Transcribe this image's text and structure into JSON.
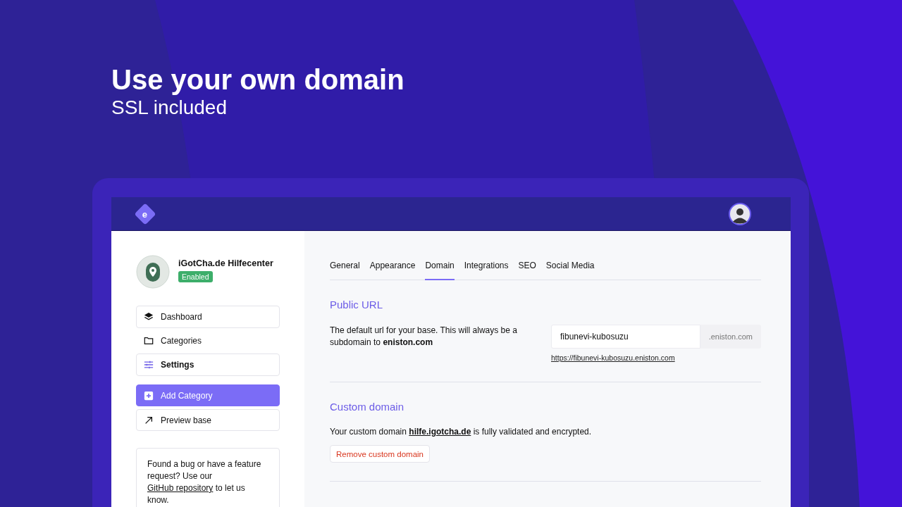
{
  "hero": {
    "title": "Use your own domain",
    "subtitle": "SSL included"
  },
  "topbar": {
    "logo_letter": "e"
  },
  "base": {
    "name": "iGotCha.de Hilfecenter",
    "status": "Enabled"
  },
  "nav": [
    {
      "label": "Dashboard",
      "kind": "layers",
      "boxed": true,
      "selected": false
    },
    {
      "label": "Categories",
      "kind": "folder",
      "boxed": false,
      "selected": false
    },
    {
      "label": "Settings",
      "kind": "sliders",
      "boxed": true,
      "selected": true
    }
  ],
  "actions": [
    {
      "label": "Add Category",
      "kind": "primary"
    },
    {
      "label": "Preview base",
      "kind": "secondary"
    }
  ],
  "feedback": {
    "before": "Found a bug or have a feature request? Use our ",
    "link": "GitHub repository",
    "after": " to let us know."
  },
  "tabs": [
    {
      "label": "General",
      "selected": false
    },
    {
      "label": "Appearance",
      "selected": false
    },
    {
      "label": "Domain",
      "selected": true
    },
    {
      "label": "Integrations",
      "selected": false
    },
    {
      "label": "SEO",
      "selected": false
    },
    {
      "label": "Social Media",
      "selected": false
    }
  ],
  "public_url": {
    "heading": "Public URL",
    "description": "The default url for your base. This will always be a subdomain to **eniston.com**",
    "value": "fibunevi-kubosuzu",
    "suffix": ".eniston.com",
    "link": "https://fibunevi-kubosuzu.eniston.com"
  },
  "custom_domain": {
    "heading": "Custom domain",
    "before": "Your custom domain ",
    "domain": "hilfe.igotcha.de",
    "after": " is fully validated and encrypted.",
    "button": "Remove custom domain"
  }
}
